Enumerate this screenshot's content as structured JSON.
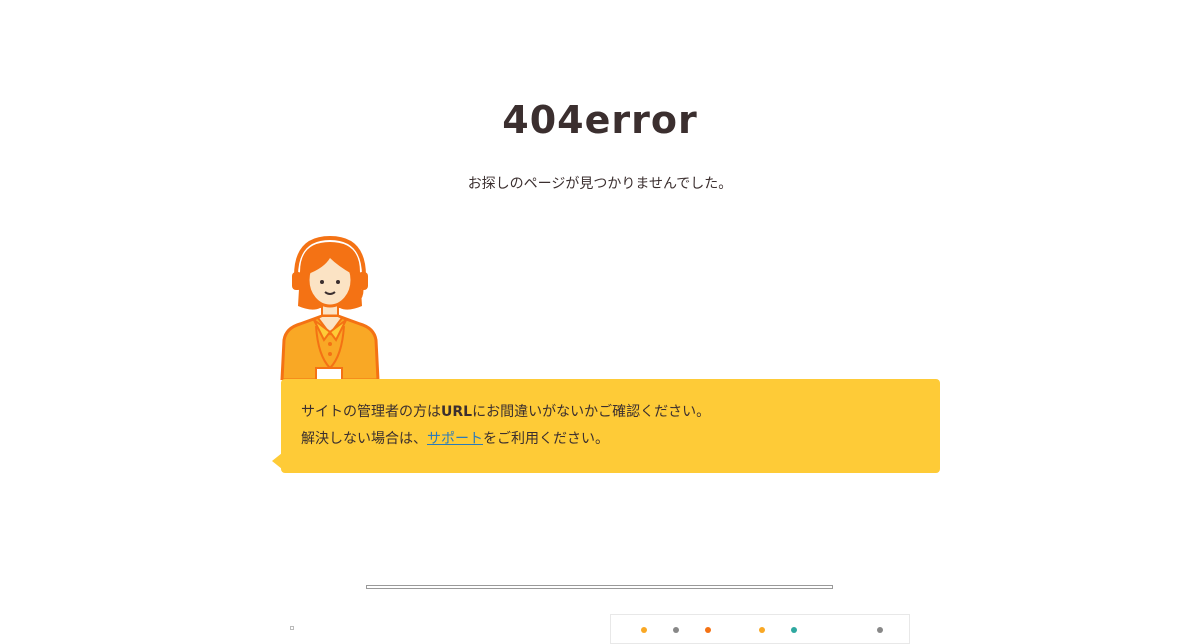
{
  "error": {
    "title": "404error",
    "subtitle": "お探しのページが見つかりませんでした。"
  },
  "message": {
    "line1_before": "サイトの管理者の方は",
    "line1_bold": "URL",
    "line1_after": "にお間違いがないかご確認ください。",
    "line2_before": "解決しない場合は、",
    "line2_link": "サポート",
    "line2_after": "をご利用ください。"
  },
  "colors": {
    "bubble": "#fecb37",
    "operator_orange": "#f47214",
    "operator_body": "#f9a825",
    "text": "#3b2f2f",
    "link": "#2b7bb9"
  },
  "icons": {
    "operator": "support-operator-illustration"
  }
}
